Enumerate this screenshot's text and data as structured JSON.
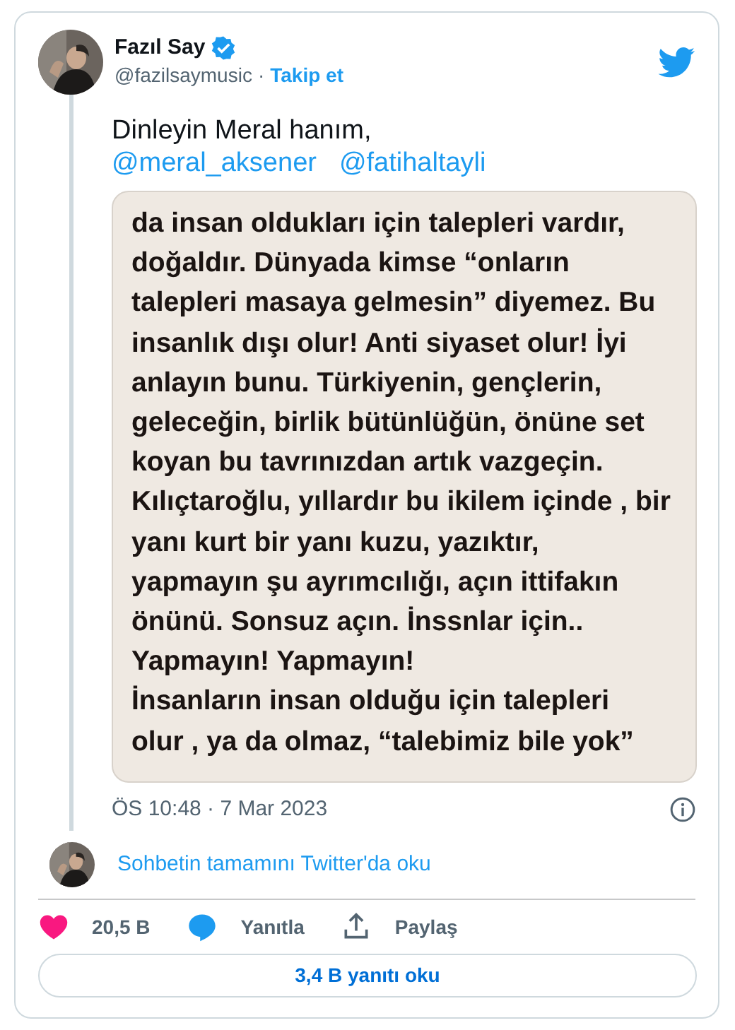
{
  "author": {
    "name": "Fazıl Say",
    "verified": true,
    "handle": "@fazilsaymusic",
    "separator": "·",
    "follow": "Takip et"
  },
  "text": "Dinleyin Meral hanım,",
  "mentions": [
    "@meral_aksener",
    "@fatihaltayli"
  ],
  "attachment": {
    "kind": "note",
    "lines": [
      "da insan oldukları için talepleri vardır,",
      "doğaldır. Dünyada kimse “onların",
      "talepleri masaya gelmesin” diyemez. Bu",
      "insanlık dışı olur! Anti siyaset olur! İyi",
      "anlayın bunu. Türkiyenin, gençlerin,",
      "geleceğin, birlik bütünlüğün, önüne set",
      "koyan bu tavrınızdan artık vazgeçin.",
      "Kılıçtaroğlu, yıllardır bu ikilem içinde , bir",
      "yanı kurt bir yanı kuzu, yazıktır,",
      "yapmayın şu ayrımcılığı, açın ittifakın",
      "önünü. Sonsuz açın. İnssnlar için..",
      "Yapmayın! Yapmayın!",
      "İnsanların insan olduğu için talepleri",
      "olur , ya da olmaz, “talebimiz bile yok”"
    ]
  },
  "timestamp": "ÖS 10:48 · 7 Mar 2023",
  "thread_link": "Sohbetin tamamını Twitter'da oku",
  "actions": [
    {
      "kind": "like",
      "label": "20,5 B"
    },
    {
      "kind": "reply",
      "label": "Yanıtla"
    },
    {
      "kind": "share",
      "label": "Paylaş"
    }
  ],
  "read_replies": "3,4 B yanıtı oku"
}
